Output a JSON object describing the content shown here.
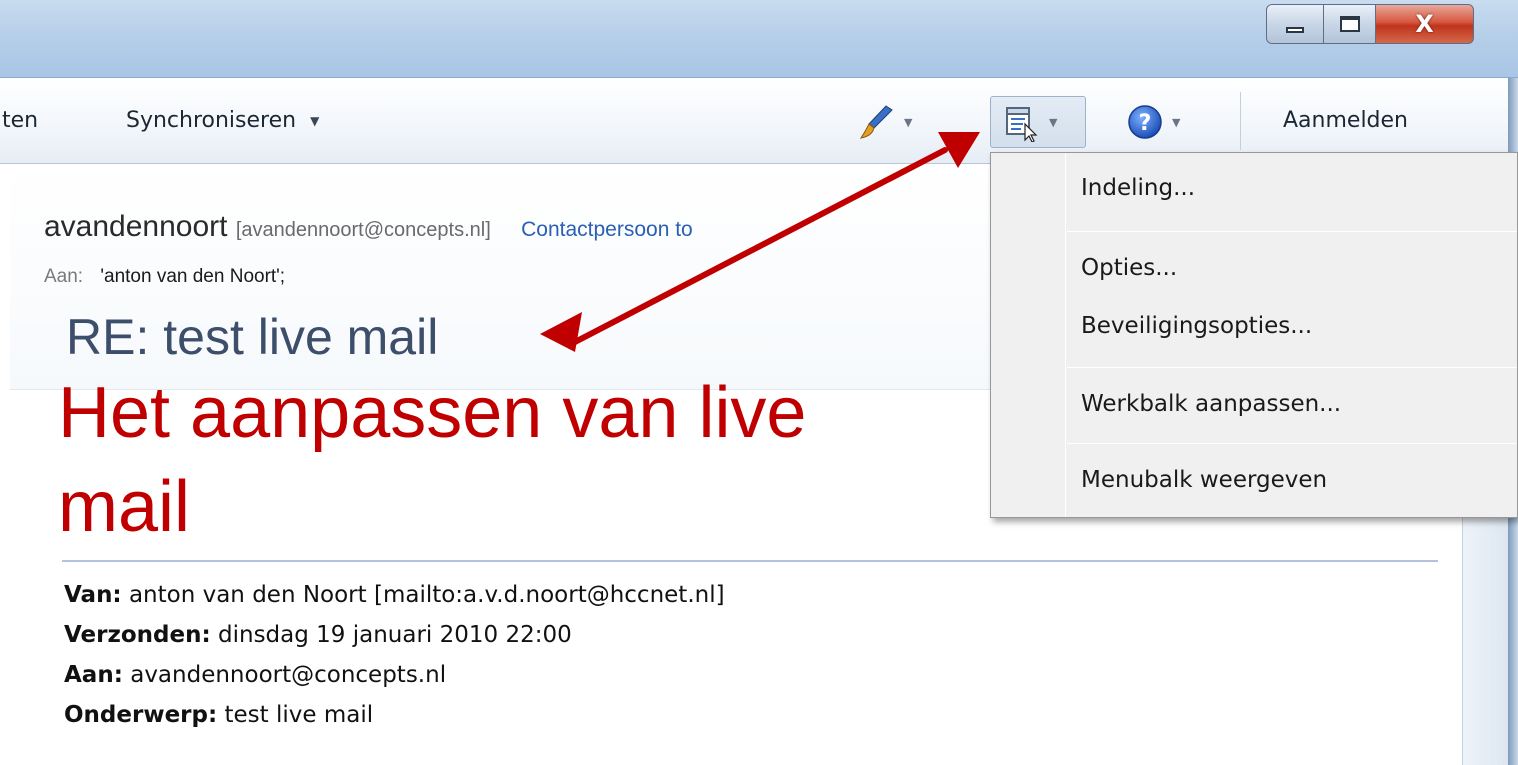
{
  "toolbar": {
    "partial_label": "ten",
    "sync_label": "Synchroniseren",
    "signin_label": "Aanmelden"
  },
  "message": {
    "sender_name": "avandennoort",
    "sender_email": "[avandennoort@concepts.nl]",
    "contact_link": "Contactpersoon to",
    "to_label": "Aan:",
    "to_value": "'anton van den Noort';",
    "subject": "RE: test live mail",
    "heading": "Het aanpassen van live mail",
    "quoted": [
      {
        "label": "Van:",
        "value": "anton van den Noort [mailto:a.v.d.noort@hccnet.nl]"
      },
      {
        "label": "Verzonden:",
        "value": "dinsdag 19 januari 2010 22:00"
      },
      {
        "label": "Aan:",
        "value": "avandennoort@concepts.nl"
      },
      {
        "label": "Onderwerp:",
        "value": "test live mail"
      }
    ]
  },
  "menu": {
    "items": [
      "Indeling...",
      "Opties...",
      "Beveiligingsopties...",
      "Werkbalk aanpassen...",
      "Menubalk weergeven"
    ]
  },
  "icons": [
    "minimize-icon",
    "maximize-icon",
    "close-icon",
    "dropdown-arrow-icon",
    "paintbrush-icon",
    "layout-menu-icon",
    "help-icon",
    "annotation-arrow"
  ],
  "colors": {
    "heading": "#c00000",
    "annotation_arrow": "#c00000",
    "link": "#2a5fb4",
    "subject": "#3c4e6a"
  }
}
